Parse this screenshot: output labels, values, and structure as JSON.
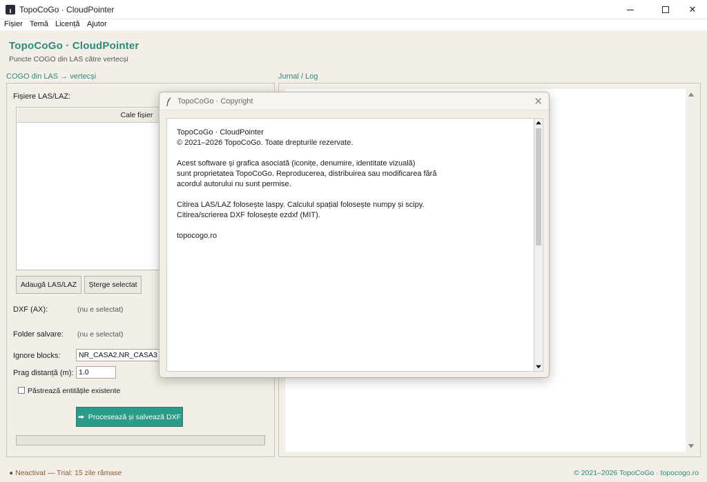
{
  "window": {
    "title": "TopoCoGo · CloudPointer"
  },
  "menu": [
    "Fișier",
    "Temă",
    "Licență",
    "Ajutor"
  ],
  "header": {
    "title": "TopoCoGo · CloudPointer",
    "subtitle": "Puncte COGO din LAS către vertecși"
  },
  "left": {
    "group_label": "COGO din LAS → vertecși",
    "files_label": "Fișiere LAS/LAZ:",
    "list_column": "Cale fișier",
    "add_button": "Adaugă LAS/LAZ",
    "delete_button": "Șterge selectat",
    "dxf_label": "DXF (AX):",
    "dxf_value": "(nu e selectat)",
    "folder_label": "Folder salvare:",
    "folder_value": "(nu e selectat)",
    "ignore_label": "Ignore blocks:",
    "ignore_value": "NR_CASA2,NR_CASA3",
    "threshold_label": "Prag distanță (m):",
    "threshold_value": "1.0",
    "keep_label": "Păstrează entitățile existente",
    "keep_checked": false,
    "process_icon": "➡",
    "process_button": "Procesează și salvează DXF",
    "progress": 0
  },
  "right": {
    "group_label": "Jurnal / Log"
  },
  "status": {
    "left": "● Neactivat — Trial: 15 zile rămase",
    "right": "© 2021–2026 TopoCoGo · topocogo.ro"
  },
  "dialog": {
    "title": "TopoCoGo · Copyright",
    "close": "✕",
    "lines": [
      "TopoCoGo · CloudPointer",
      "© 2021–2026 TopoCoGo. Toate drepturile rezervate.",
      "",
      "Acest software și grafica asociată (iconițe, denumire, identitate vizuală)",
      "sunt proprietatea TopoCoGo. Reproducerea, distribuirea sau modificarea fără",
      "acordul autorului nu sunt permise.",
      "",
      "Citirea LAS/LAZ folosește laspy. Calculul spațial folosește numpy și scipy.",
      "Citirea/scrierea DXF folosește ezdxf (MIT).",
      "",
      "topocogo.ro"
    ]
  },
  "colors": {
    "accent": "#2a8a7a",
    "button_primary": "#2a9c87",
    "status_warning": "#8a5a2a",
    "background": "#f3efe8"
  }
}
